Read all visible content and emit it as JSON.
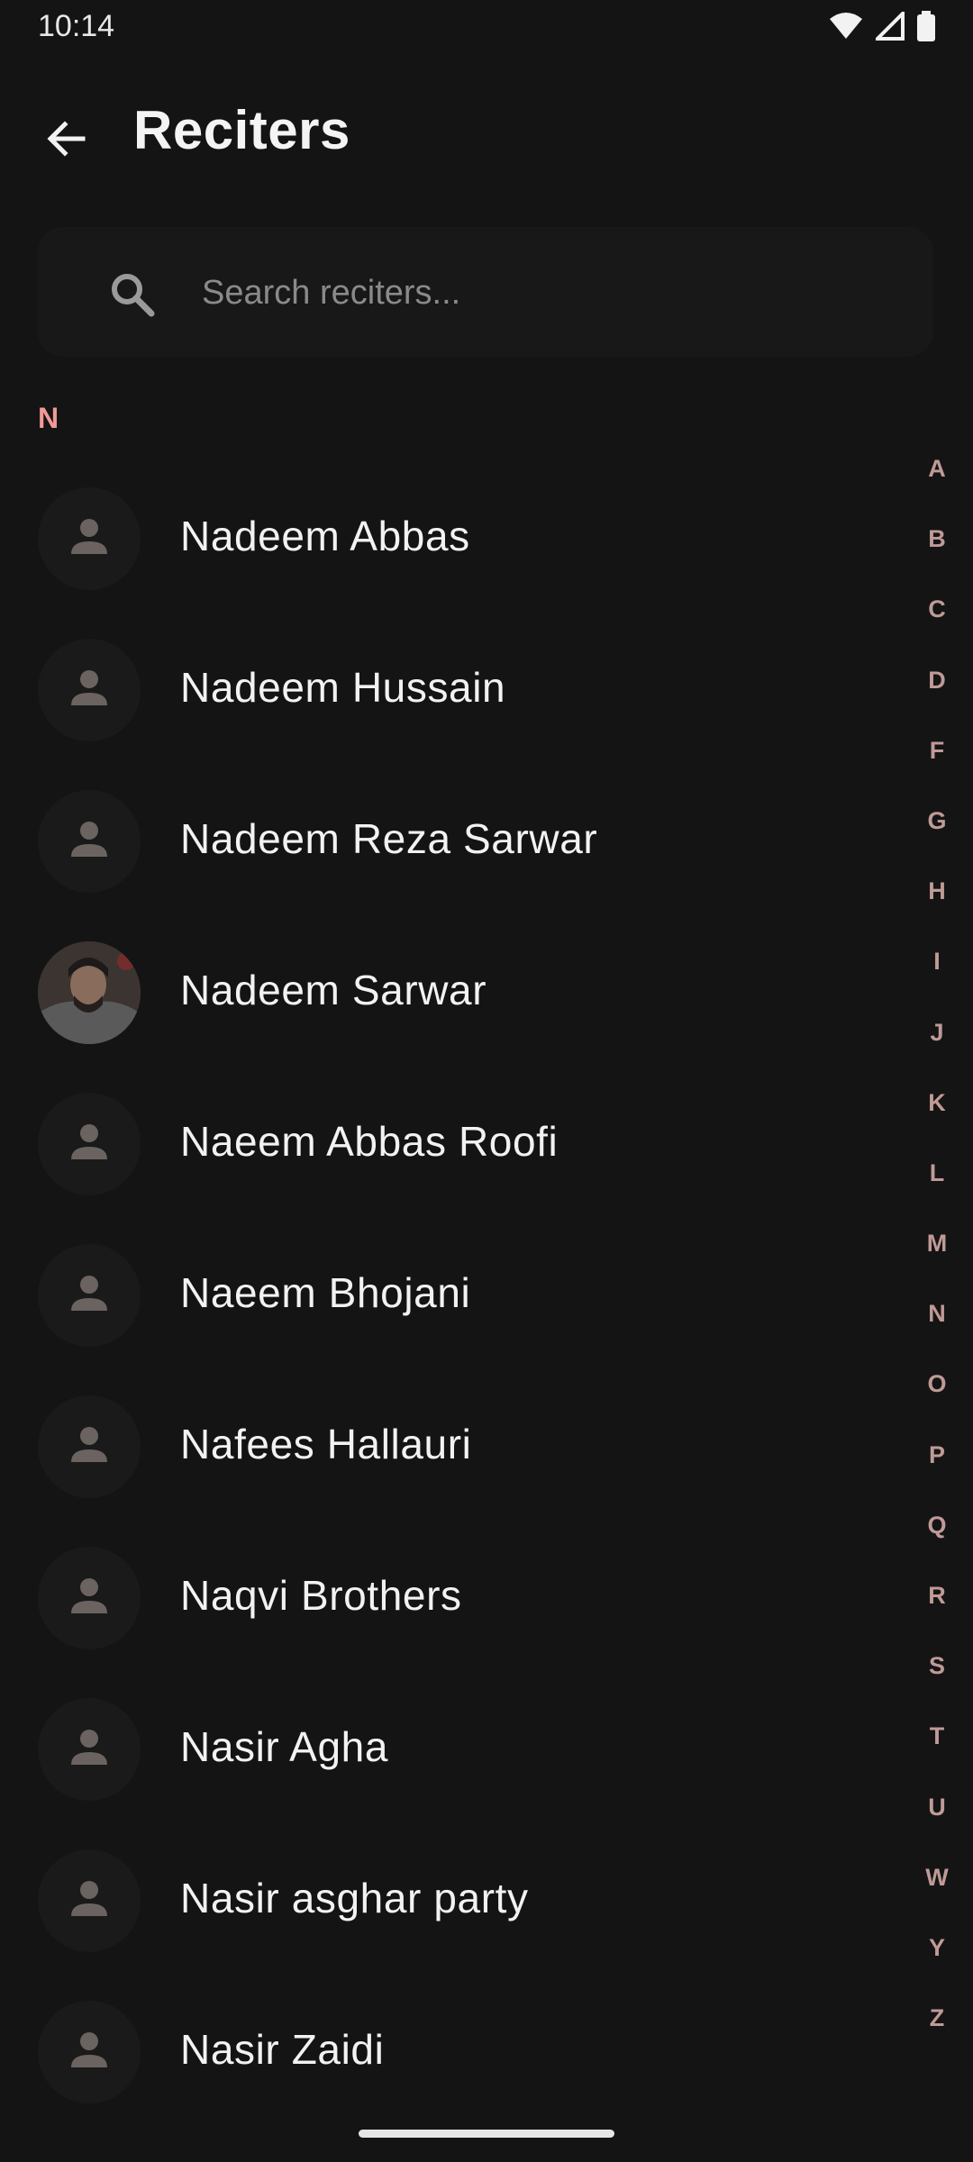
{
  "status_bar": {
    "time": "10:14",
    "icons": [
      "wifi-icon",
      "signal-icon",
      "battery-icon"
    ]
  },
  "header": {
    "back_icon": "arrow-left-icon",
    "title": "Reciters"
  },
  "search": {
    "icon": "search-icon",
    "placeholder": "Search reciters...",
    "value": ""
  },
  "section": {
    "letter": "N"
  },
  "reciters": [
    {
      "name": "Nadeem Abbas",
      "avatar": "person-icon"
    },
    {
      "name": "Nadeem Hussain",
      "avatar": "person-icon"
    },
    {
      "name": "Nadeem Reza Sarwar",
      "avatar": "person-icon"
    },
    {
      "name": "Nadeem Sarwar",
      "avatar": "photo"
    },
    {
      "name": "Naeem Abbas Roofi",
      "avatar": "person-icon"
    },
    {
      "name": "Naeem Bhojani",
      "avatar": "person-icon"
    },
    {
      "name": "Nafees Hallauri",
      "avatar": "person-icon"
    },
    {
      "name": "Naqvi Brothers",
      "avatar": "person-icon"
    },
    {
      "name": "Nasir Agha",
      "avatar": "person-icon"
    },
    {
      "name": "Nasir asghar party",
      "avatar": "person-icon"
    },
    {
      "name": "Nasir Zaidi",
      "avatar": "person-icon"
    }
  ],
  "alphabet_index": [
    "A",
    "B",
    "C",
    "D",
    "F",
    "G",
    "H",
    "I",
    "J",
    "K",
    "L",
    "M",
    "N",
    "O",
    "P",
    "Q",
    "R",
    "S",
    "T",
    "U",
    "W",
    "Y",
    "Z"
  ],
  "colors": {
    "background": "#141414",
    "section_accent": "#f19a97",
    "index_text": "#bf9a97"
  }
}
